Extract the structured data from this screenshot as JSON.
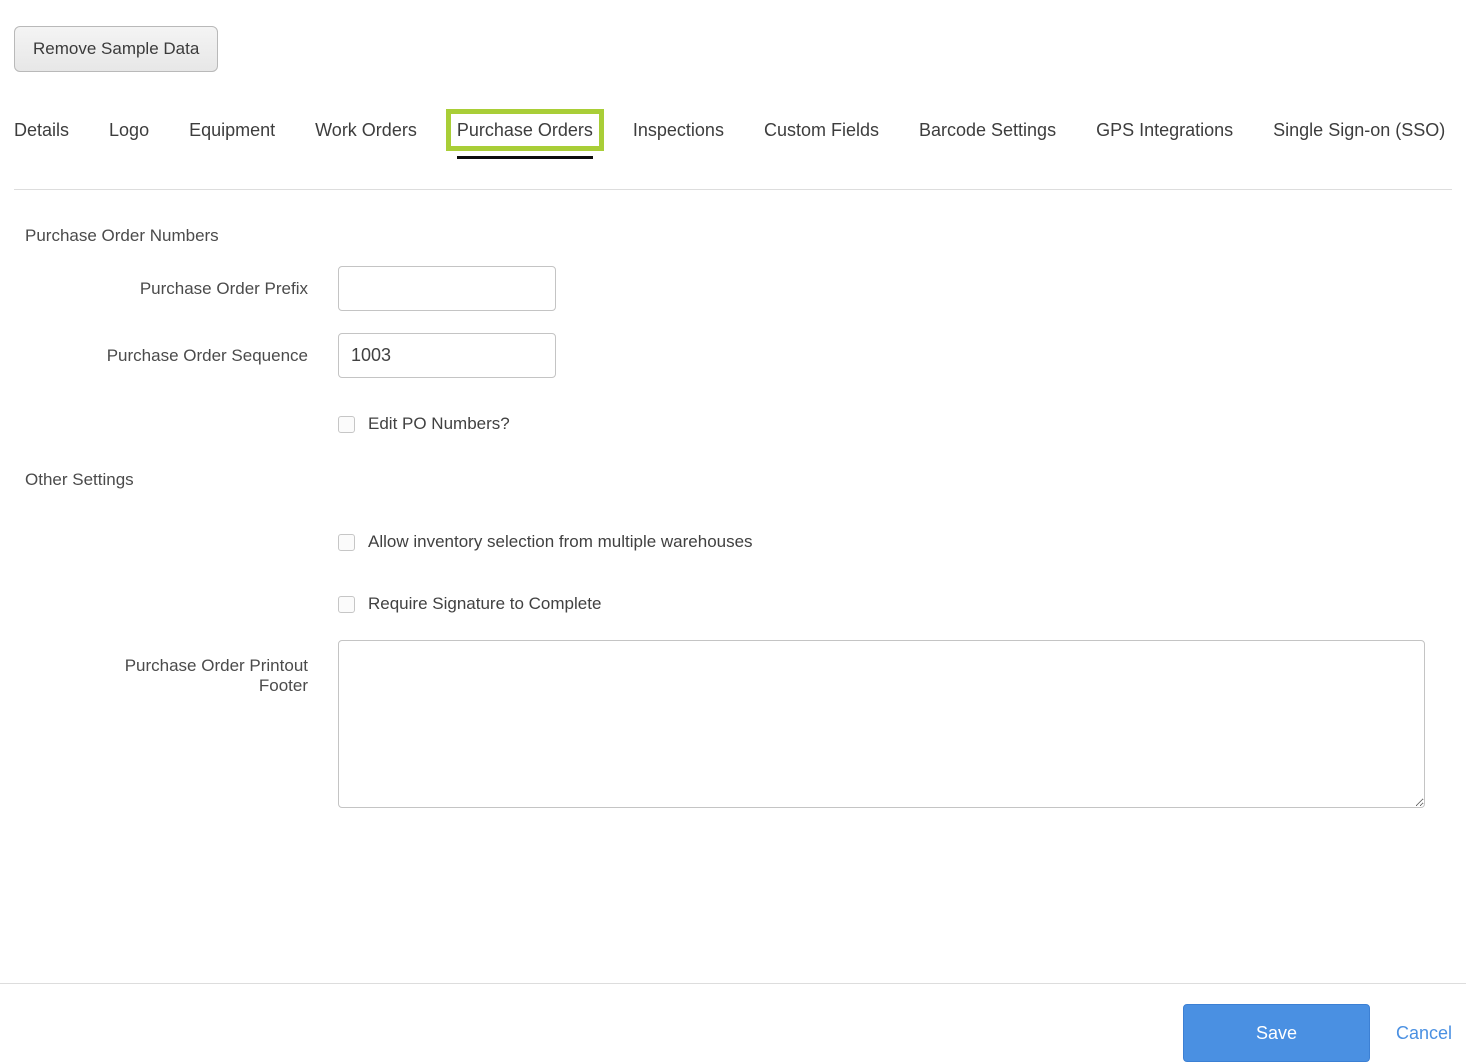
{
  "header": {
    "remove_sample_data_label": "Remove Sample Data"
  },
  "tabs": {
    "items": [
      {
        "label": "Details",
        "active": false
      },
      {
        "label": "Logo",
        "active": false
      },
      {
        "label": "Equipment",
        "active": false
      },
      {
        "label": "Work Orders",
        "active": false
      },
      {
        "label": "Purchase Orders",
        "active": true,
        "highlighted": true
      },
      {
        "label": "Inspections",
        "active": false
      },
      {
        "label": "Custom Fields",
        "active": false
      },
      {
        "label": "Barcode Settings",
        "active": false
      },
      {
        "label": "GPS Integrations",
        "active": false
      },
      {
        "label": "Single Sign-on (SSO)",
        "active": false
      }
    ]
  },
  "form": {
    "po_numbers": {
      "title": "Purchase Order Numbers",
      "prefix_label": "Purchase Order Prefix",
      "prefix_value": "",
      "sequence_label": "Purchase Order Sequence",
      "sequence_value": "1003",
      "edit_po_label": "Edit PO Numbers?",
      "edit_po_checked": false
    },
    "other_settings": {
      "title": "Other Settings",
      "multi_warehouse_label": "Allow inventory selection from multiple warehouses",
      "multi_warehouse_checked": false,
      "require_signature_label": "Require Signature to Complete",
      "require_signature_checked": false,
      "printout_footer_label": "Purchase Order Printout Footer",
      "printout_footer_value": ""
    }
  },
  "footer": {
    "save_label": "Save",
    "cancel_label": "Cancel"
  },
  "colors": {
    "primary_blue": "#4a90e2",
    "highlight_green": "#a9ce37",
    "tab_underline": "#000000"
  }
}
